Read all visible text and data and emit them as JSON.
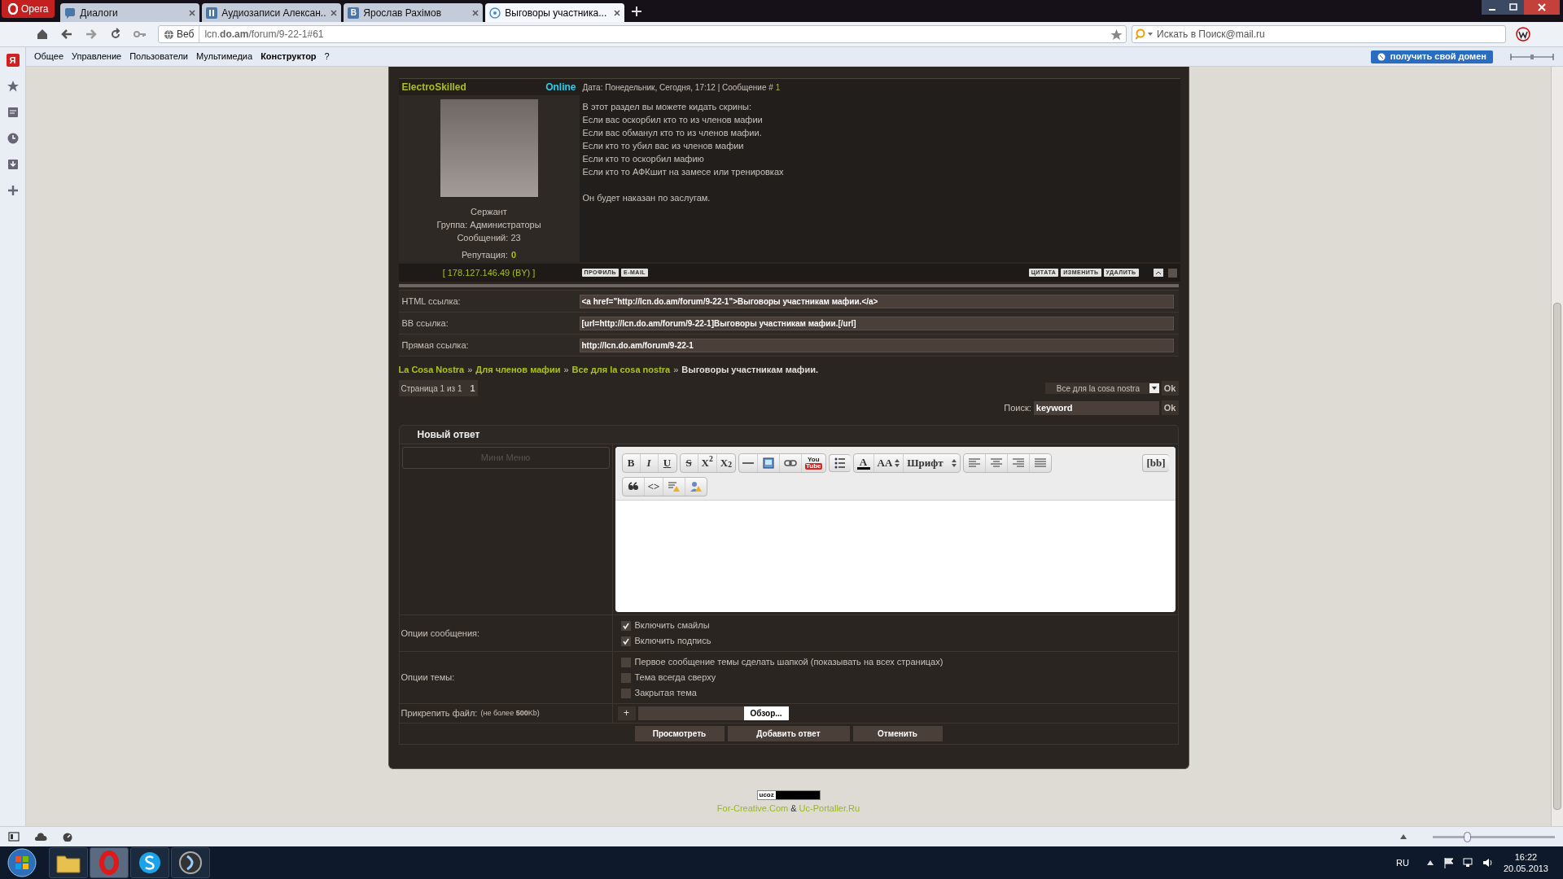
{
  "browser": {
    "menu_button": "Opera",
    "zoom": {
      "level": 0.27
    },
    "tabs": [
      {
        "label": "Диалоги",
        "kind": "chat",
        "selected": false
      },
      {
        "label": "Аудиозаписи Алексан...",
        "kind": "audio",
        "selected": false
      },
      {
        "label": "Ярослав Рахімов",
        "kind": "vk",
        "icon_text": "В",
        "selected": false
      },
      {
        "label": "Выговоры участника...",
        "kind": "page",
        "selected": true
      }
    ],
    "address": {
      "badge": "Веб",
      "url": "lcn.**do.am**/forum/9-22-1#61"
    },
    "search": {
      "placeholder": "Искать в Поиск@mail.ru"
    },
    "panel_logo": "Я",
    "menu": [
      {
        "label": "Общее",
        "bold": false
      },
      {
        "label": "Управление",
        "bold": false
      },
      {
        "label": "Пользователи",
        "bold": false
      },
      {
        "label": "Мультимедиа",
        "bold": false
      },
      {
        "label": "Конструктор",
        "bold": true
      },
      {
        "label": "?",
        "bold": false
      }
    ],
    "domain_button": "получить свой домен"
  },
  "post": {
    "author": "ElectroSkilled",
    "status": "Online",
    "meta": "Дата: Понедельник, Сегодня, 17:12 | Сообщение #",
    "number": "1",
    "rank": "Сержант",
    "group": "Группа: Администраторы",
    "count": "Сообщений: 23",
    "reputation_label": "Репутация:",
    "reputation": "0",
    "paragraphs": [
      [
        "В этот раздел вы можете кидать скрины:",
        "Если вас оскорбил кто то из членов мафии",
        "Если вас обманул кто то из членов мафии.",
        "Если кто то убил вас из членов мафии",
        "Если кто то оскорбил мафию",
        "Если кто то АФКшит на замесе или тренировках"
      ],
      [
        "Он будет наказан по заслугам."
      ]
    ],
    "ip": "[ 178.127.146.49 (BY) ]",
    "checked": false,
    "left_buttons": [
      "ПРОФИЛЬ",
      "E-MAIL"
    ],
    "right_buttons": [
      "ЦИТАТА",
      "ИЗМЕНИТЬ",
      "УДАЛИТЬ"
    ]
  },
  "links": [
    {
      "label": "HTML ссылка:",
      "value": "<a href=\"http://lcn.do.am/forum/9-22-1\">Выговоры участникам мафии.</a>"
    },
    {
      "label": "BB ссылка:",
      "value": "[url=http://lcn.do.am/forum/9-22-1]Выговоры участникам мафии.[/url]"
    },
    {
      "label": "Прямая ссылка:",
      "value": "http://lcn.do.am/forum/9-22-1"
    }
  ],
  "breadcrumbs": {
    "items": [
      "La Cosa Nostra",
      "Для членов мафии",
      "Все для la cosa nostra"
    ],
    "separator": "»",
    "current": "Выговоры участникам мафии."
  },
  "pagination": {
    "label": "Страница 1 из 1",
    "page": "1"
  },
  "jump": {
    "value": "Все для la cosa nostra",
    "button": "Ok"
  },
  "search": {
    "label": "Поиск:",
    "value": "keyword",
    "button": "Ok"
  },
  "reply": {
    "title": "Новый ответ",
    "mini_menu": "Мини Меню",
    "toolbar": [
      [
        {
          "items": [
            {
              "kind": "text",
              "label": "B"
            },
            {
              "kind": "text",
              "label": "I"
            },
            {
              "kind": "text",
              "label": "U"
            }
          ]
        },
        {
          "items": [
            {
              "kind": "text",
              "label": "S"
            },
            {
              "kind": "text",
              "label": "X$^{2}$"
            },
            {
              "kind": "text",
              "label": "X$_{2}$"
            }
          ]
        },
        {
          "items": [
            {
              "kind": "line"
            },
            {
              "kind": "image"
            },
            {
              "kind": "link"
            },
            {
              "kind": "video",
              "label": "You",
              "sublabel": "Tube"
            }
          ]
        },
        {
          "items": [
            {
              "kind": "list"
            }
          ]
        },
        {
          "items": [
            {
              "kind": "color",
              "label": "A"
            },
            {
              "kind": "size",
              "label": "AA"
            },
            {
              "kind": "font",
              "label": "Шрифт"
            }
          ]
        },
        {
          "items": [
            {
              "kind": "align_left"
            },
            {
              "kind": "align_center"
            },
            {
              "kind": "align_right"
            },
            {
              "kind": "justify"
            }
          ]
        },
        {
          "items": [
            {
              "kind": "text",
              "label": "[bb]"
            }
          ]
        }
      ],
      [
        {
          "items": [
            {
              "kind": "quote"
            },
            {
              "kind": "text",
              "label": "<>"
            },
            {
              "kind": "hide"
            },
            {
              "kind": "user"
            }
          ]
        }
      ]
    ],
    "option_groups": [
      {
        "label": "Опции сообщения:",
        "options": [
          {
            "label": "Включить смайлы",
            "checked": true
          },
          {
            "label": "Включить подпись",
            "checked": true
          }
        ]
      },
      {
        "label": "Опции темы:",
        "options": [
          {
            "label": "Первое сообщение темы сделать шапкой (показывать на всех страницах)",
            "checked": false
          },
          {
            "label": "Тема всегда сверху",
            "checked": false
          },
          {
            "label": "Закрытая тема",
            "checked": false
          }
        ]
      }
    ],
    "attach": {
      "label": "Прикрепить файл:",
      "note": "(не более **500**Kb)",
      "add": "+",
      "browse": "Обзор..."
    },
    "buttons": [
      "Просмотреть",
      "Добавить ответ",
      "Отменить"
    ]
  },
  "footer": {
    "badge": "ucoz",
    "links": [
      "For-Creative.Com",
      "Uc-Portaller.Ru"
    ],
    "joiner": "&"
  },
  "taskbar": {
    "language": "RU",
    "time": "16:22",
    "date": "20.05.2013"
  }
}
